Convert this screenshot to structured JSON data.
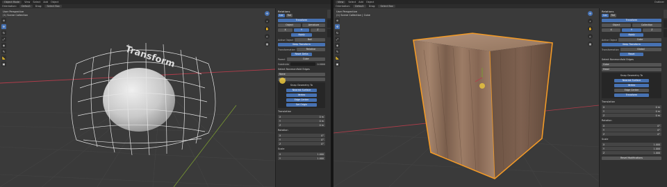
{
  "left": {
    "header_menus": [
      "Object Mode",
      "View",
      "Select",
      "Add",
      "Object"
    ],
    "header2": {
      "orientation_label": "Orientation:",
      "orientation_value": "Default",
      "drag_label": "Drag:",
      "drag_value": "Select Box"
    },
    "viewport": {
      "line1": "User Perspective",
      "line2": "(1) Scene Collection"
    },
    "viewport_text": "Transform",
    "panel": {
      "title": "Relations",
      "transform_label": "Transform",
      "loc_rot": [
        "Loc",
        "Rot"
      ],
      "parent_btns": [
        "Object",
        "Armature"
      ],
      "tabs": [
        "X",
        "Y",
        "Z"
      ],
      "apply": "Apply",
      "active_object_label": "Active Object",
      "active_object_value": "Ball",
      "parent_keep": "Keep Transform",
      "transformation_label": "Transformation",
      "transformation_value": "Relative",
      "reset_btn": "Reset Delta",
      "add_label": "Add",
      "parent_row": [
        "Parent",
        "Cube"
      ],
      "sub_label": "Subdivide",
      "sub_value": "0.0000",
      "select_label": "Select Nonmanifold Edges",
      "dropdown1": "None",
      "dropdown2": "Head",
      "snap_label": "Snap Geometry To",
      "snap_btns": [
        "Nearest Surface",
        "Vertex",
        "Edge Center"
      ],
      "set_origin": "Set Origin",
      "translation_label": "Translation",
      "translation_vals": [
        "0 m",
        "0 m",
        "0 m"
      ],
      "rotation_label": "Rotation",
      "rotation_vals": [
        "0°",
        "0°",
        "0°"
      ],
      "scale_label": "Scale",
      "scale_vals": [
        "1.000",
        "1.000",
        "1.000"
      ]
    }
  },
  "right": {
    "header_menus": [
      "View",
      "Select",
      "Add",
      "Object"
    ],
    "header2": {
      "orientation_label": "Orientation:",
      "orientation_value": "Default",
      "drag_label": "Drag:",
      "drag_value": "Select Box"
    },
    "viewport": {
      "line1": "User Perspective",
      "line2": "(1) Scene Collection | Cube"
    },
    "outliner_label": "Outliner",
    "panel": {
      "title": "Relations",
      "loc_rot": [
        "Loc",
        "Rot"
      ],
      "transform_label": "Transform",
      "parent_btns": [
        "Object",
        "Collection"
      ],
      "tabs": [
        "X",
        "Y",
        "Z"
      ],
      "apply": "Apply",
      "active_object_label": "Active Object",
      "active_object_value": "Cube",
      "parent_keep": "Keep Transform",
      "transformation_label": "Transformation",
      "transformation_value": "Global",
      "reset_btn": "Reset",
      "select_label": "Select Nonmanifold Edges",
      "dropdown1": "Cube",
      "dropdown2": "Head",
      "snap_label": "Snap Geometry To",
      "snap_btns": [
        "Nearest Surface",
        "Vertex",
        "Edge Center"
      ],
      "set_origin": "Transform",
      "translation_label": "Translation",
      "translation_vals": [
        "0 m",
        "0 m",
        "0 m"
      ],
      "rotation_label": "Rotation",
      "rotation_vals": [
        "0°",
        "0°",
        "0°"
      ],
      "scale_label": "Scale",
      "scale_vals": [
        "1.000",
        "1.000",
        "1.000"
      ],
      "footer_btn": "Reset Modifications"
    }
  },
  "colors": {
    "accent": "#4772b3",
    "selection": "#f29a27",
    "axis_x": "#b33d4b",
    "axis_y": "#7a9a32"
  },
  "icons": [
    "cursor-icon",
    "move-icon",
    "rotate-icon",
    "scale-icon",
    "transform-icon",
    "annotate-icon",
    "measure-icon",
    "add-cube-icon",
    "zoom-icon",
    "pan-icon",
    "camera-icon",
    "grid-icon"
  ]
}
